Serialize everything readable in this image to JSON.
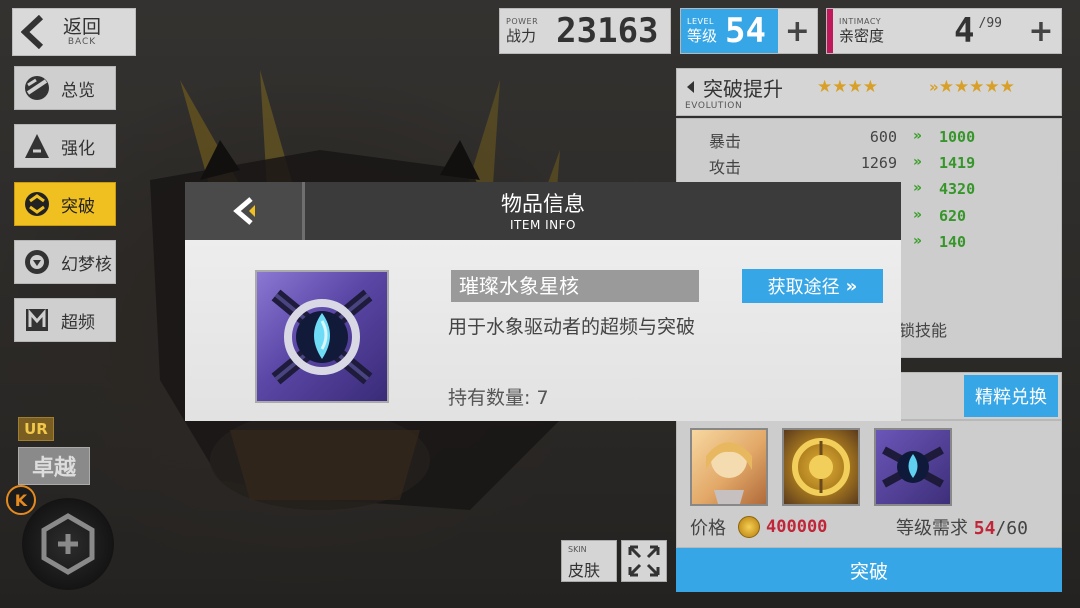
{
  "top_bar": {
    "back": {
      "label": "返回",
      "sub": "BACK"
    },
    "power": {
      "en": "POWER",
      "label": "战力",
      "value": "23163"
    },
    "level": {
      "en": "LEVEL",
      "label": "等级",
      "value": "54",
      "plus": "+"
    },
    "intimacy": {
      "en": "INTIMACY",
      "label": "亲密度",
      "value": "4",
      "max": "/99",
      "plus": "+"
    }
  },
  "sidebar": {
    "items": [
      {
        "label": "总览",
        "icon": "overview-icon"
      },
      {
        "label": "强化",
        "icon": "enhance-icon"
      },
      {
        "label": "突破",
        "icon": "breakthrough-icon",
        "active": true
      },
      {
        "label": "幻梦核",
        "icon": "dream-core-icon"
      },
      {
        "label": "超频",
        "icon": "overclock-icon"
      }
    ],
    "rank": "UR",
    "rank_name": "卓越",
    "k_badge": "K"
  },
  "evolution": {
    "title": "突破提升",
    "en": "EVOLUTION",
    "stars_current": "★★★★",
    "stars_next_arrow": "»",
    "stars_next": "★★★★★",
    "stats": [
      {
        "name": "暴击",
        "current": "600",
        "next": "1000"
      },
      {
        "name": "攻击",
        "current": "1269",
        "next": "1419"
      },
      {
        "name": "",
        "current": "",
        "next": "4320"
      },
      {
        "name": "",
        "current": "",
        "next": "620"
      },
      {
        "name": "",
        "current": "",
        "next": "140"
      }
    ],
    "chevron": "»",
    "skill_text": "锁技能"
  },
  "materials": {
    "exchange_label": "精粹兑换",
    "items": [
      {
        "icon": "character-fragment-icon",
        "count": ""
      },
      {
        "icon": "gold-core-icon",
        "count": ""
      },
      {
        "icon": "water-star-core-icon",
        "count": ""
      }
    ],
    "price_label": "价格",
    "price_value": "400000",
    "req_label": "等级需求",
    "req_current": "54",
    "req_max": "/60",
    "evolve_label": "突破"
  },
  "skin": {
    "en": "SKIN",
    "label": "皮肤"
  },
  "modal": {
    "title": "物品信息",
    "subtitle": "ITEM INFO",
    "item_name": "璀璨水象星核",
    "obtain_label": "获取途径",
    "obtain_arrow": "»",
    "description": "用于水象驱动者的超频与突破",
    "quantity": "持有数量: 7"
  },
  "colors": {
    "accent_blue": "#37a6e6",
    "active_yellow": "#f0c020",
    "green_up": "#36962a",
    "red": "#c0263a"
  }
}
